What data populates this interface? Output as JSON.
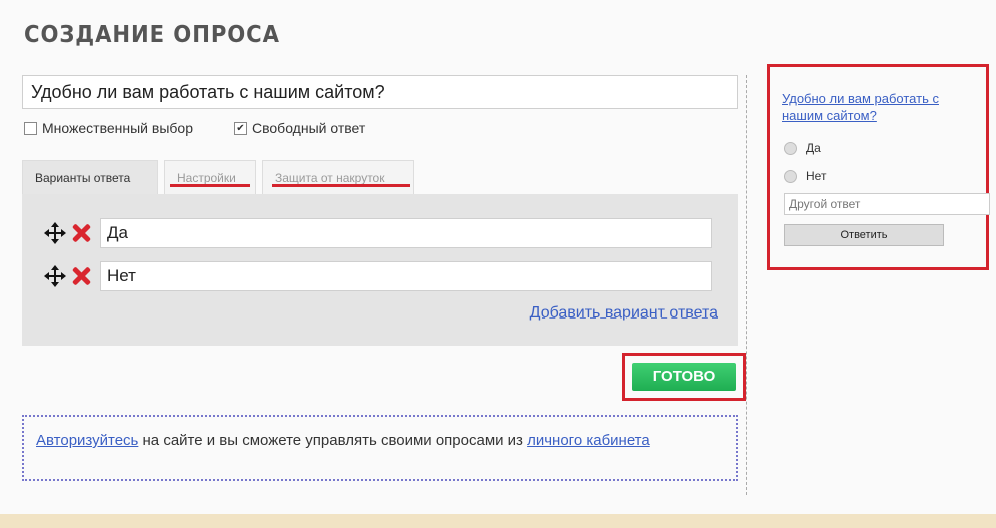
{
  "page": {
    "title": "СОЗДАНИЕ ОПРОСА"
  },
  "question": {
    "value": "Удобно ли вам работать с нашим сайтом?"
  },
  "options": {
    "multiple": "Множественный выбор",
    "free": "Свободный ответ",
    "free_checked": "✔"
  },
  "tabs": [
    {
      "label": "Варианты ответа"
    },
    {
      "label": "Настройки"
    },
    {
      "label": "Защита от накруток"
    }
  ],
  "answers": [
    {
      "value": "Да"
    },
    {
      "value": "Нет"
    }
  ],
  "add_answer": "Добавить вариант ответа",
  "done_button": "ГОТОВО",
  "auth": {
    "link1": "Авторизуйтесь",
    "text": " на сайте и вы сможете управлять своими опросами из ",
    "link2": "личного кабинета"
  },
  "preview": {
    "question": "Удобно ли вам работать с нашим сайтом?",
    "options": [
      "Да",
      "Нет"
    ],
    "other_placeholder": "Другой ответ",
    "submit": "Ответить"
  },
  "colors": {
    "accent_red": "#d4232d",
    "green": "#25b85b",
    "link": "#3a5fc4"
  }
}
